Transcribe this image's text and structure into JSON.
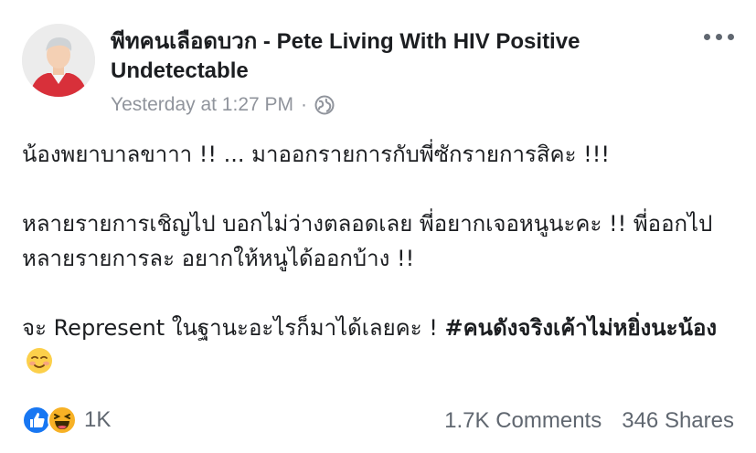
{
  "post": {
    "author": "พีทคนเลือดบวก - Pete Living With HIV Positive Undetectable",
    "timestamp": "Yesterday at 1:27 PM",
    "separator": "·",
    "privacy_icon": "globe-icon",
    "more_icon": "more-options-icon",
    "paragraphs": [
      "น้องพยาบาลขาาา !! ... มาออกรายการกับพี่ซักรายการสิคะ !!!",
      "หลายรายการเชิญไป บอกไม่ว่างตลอดเลย พี่อยากเจอหนูนะคะ !! พี่ออกไปหลายรายการละ อยากให้หนูได้ออกบ้าง !!"
    ],
    "last_paragraph": {
      "text": "จะ Represent ในฐานะอะไรก็มาได้เลยคะ ! ",
      "hashtag": "#คนดังจริงเค้าไม่หยิ่งนะน้อง",
      "emoji": "smiling-face-icon"
    },
    "reactions": {
      "icons": [
        "like-icon",
        "haha-icon"
      ],
      "count": "1K"
    },
    "comments": "1.7K Comments",
    "shares": "346 Shares"
  },
  "colors": {
    "text": "#1c1e21",
    "meta": "#90949c",
    "stats": "#606770",
    "like_blue": "#1877f2",
    "haha_yellow": "#f7b125"
  }
}
